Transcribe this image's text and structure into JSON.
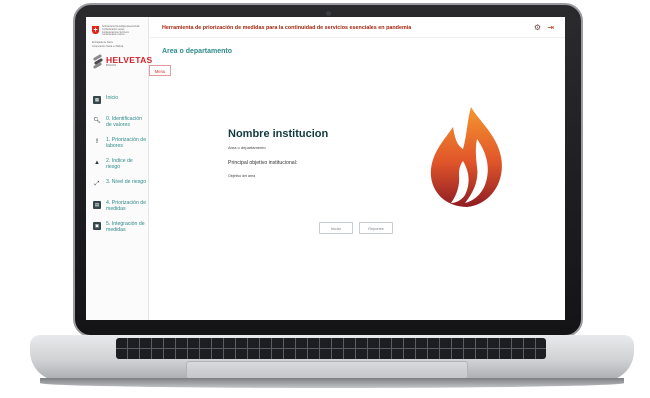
{
  "sidebar": {
    "fed_lines": [
      "Schweizerische Eidgenossenschaft",
      "Confédération suisse",
      "Confederazione Svizzera",
      "Confederaziun svizra"
    ],
    "fed_sub": [
      "Embajada de Suiza",
      "Cooperación Suiza en Bolivia"
    ],
    "helvetas_name": "HELVETAS",
    "helvetas_sub": "BOLIVIA",
    "nav": [
      {
        "icon": "home-icon",
        "label": "Inicio"
      },
      {
        "icon": "search-icon",
        "label": "0. Identificación de valores"
      },
      {
        "icon": "exclamation-icon",
        "label": "1. Priorización de labores"
      },
      {
        "icon": "warning-triangle-icon",
        "label": "2. Indice de riesgo"
      },
      {
        "icon": "trend-line-icon",
        "label": "3. Nivel de riesgo"
      },
      {
        "icon": "priority-chart-icon",
        "label": "4. Priorización de medidas"
      },
      {
        "icon": "integration-icon",
        "label": "5. Integración de medidas"
      }
    ]
  },
  "header": {
    "title": "Herramienta de priorización de medidas para la continuidad de servicios esenciales en pandemia"
  },
  "main": {
    "department_title": "Area o departamento",
    "menu_label": "Menu",
    "institution_name": "Nombre institucion",
    "department": "Area o departamento",
    "objective_label": "Principal objetivo institucional:",
    "objective": "Objetivo del area",
    "buttons": {
      "start": "Iniciar",
      "reports": "Reportes"
    }
  },
  "colors": {
    "accent_teal": "#2e8a8a",
    "title_red": "#a3260f",
    "flame_orange": "#f07f2a",
    "flame_red": "#c92a2a"
  }
}
